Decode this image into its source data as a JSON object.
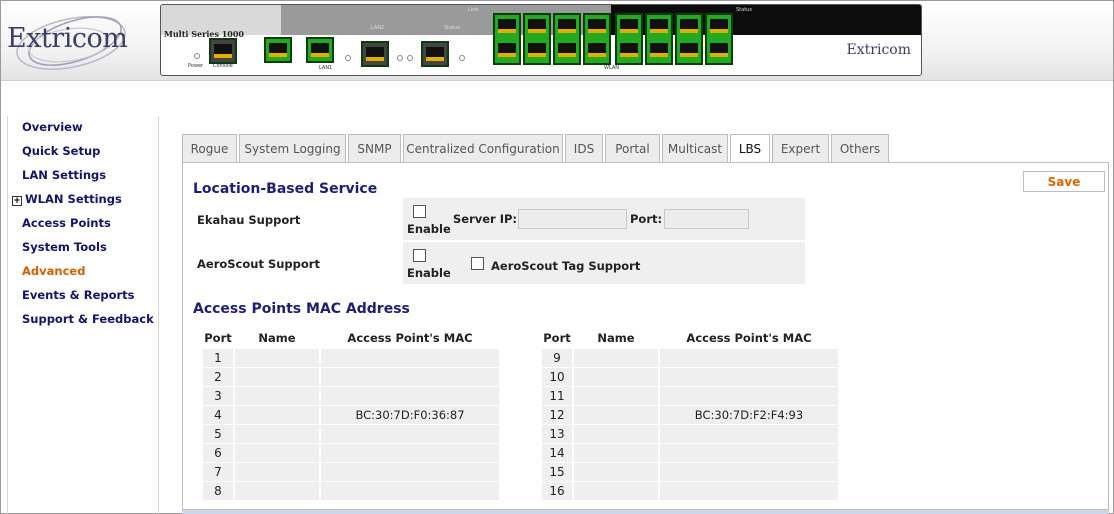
{
  "header": {
    "brand": "Extricom",
    "device_model": "Multi Series 1000",
    "device_brand": "Extricom",
    "labels": {
      "power": "Power",
      "console": "Console",
      "lan1": "LAN1",
      "lan2": "LAN2",
      "link": "Link",
      "status": "Status",
      "wlan": "WLAN"
    }
  },
  "sidebar": {
    "items": [
      {
        "label": "Overview"
      },
      {
        "label": "Quick Setup"
      },
      {
        "label": "LAN Settings"
      },
      {
        "label": "WLAN Settings",
        "expandable": true,
        "expand_symbol": "+"
      },
      {
        "label": "Access Points"
      },
      {
        "label": "System Tools"
      },
      {
        "label": "Advanced",
        "active": true
      },
      {
        "label": "Events & Reports"
      },
      {
        "label": "Support & Feedback"
      }
    ]
  },
  "tabs": [
    {
      "label": "Rogue"
    },
    {
      "label": "System Logging"
    },
    {
      "label": "SNMP"
    },
    {
      "label": "Centralized Configuration"
    },
    {
      "label": "IDS"
    },
    {
      "label": "Portal"
    },
    {
      "label": "Multicast"
    },
    {
      "label": "LBS",
      "active": true
    },
    {
      "label": "Expert"
    },
    {
      "label": "Others"
    }
  ],
  "lbs": {
    "title": "Location-Based Service",
    "save_label": "Save",
    "ekahau": {
      "label": "Ekahau Support",
      "enable_label": "Enable",
      "enabled": false,
      "server_ip_label": "Server IP:",
      "server_ip_value": "",
      "port_label": "Port:",
      "port_value": ""
    },
    "aeroscout": {
      "label": "AeroScout Support",
      "enable_label": "Enable",
      "enabled": false,
      "tag_support_label": "AeroScout Tag Support",
      "tag_support": false
    }
  },
  "mac_section": {
    "title": "Access Points MAC Address",
    "columns": {
      "port": "Port",
      "name": "Name",
      "mac": "Access Point's MAC"
    },
    "left_rows": [
      {
        "port": "1",
        "name": "",
        "mac": ""
      },
      {
        "port": "2",
        "name": "",
        "mac": ""
      },
      {
        "port": "3",
        "name": "",
        "mac": ""
      },
      {
        "port": "4",
        "name": "",
        "mac": "BC:30:7D:F0:36:87"
      },
      {
        "port": "5",
        "name": "",
        "mac": ""
      },
      {
        "port": "6",
        "name": "",
        "mac": ""
      },
      {
        "port": "7",
        "name": "",
        "mac": ""
      },
      {
        "port": "8",
        "name": "",
        "mac": ""
      }
    ],
    "right_rows": [
      {
        "port": "9",
        "name": "",
        "mac": ""
      },
      {
        "port": "10",
        "name": "",
        "mac": ""
      },
      {
        "port": "11",
        "name": "",
        "mac": ""
      },
      {
        "port": "12",
        "name": "",
        "mac": "BC:30:7D:F2:F4:93"
      },
      {
        "port": "13",
        "name": "",
        "mac": ""
      },
      {
        "port": "14",
        "name": "",
        "mac": ""
      },
      {
        "port": "15",
        "name": "",
        "mac": ""
      },
      {
        "port": "16",
        "name": "",
        "mac": ""
      }
    ]
  },
  "colors": {
    "nav_text": "#14146b",
    "nav_active": "#d46000",
    "section_title": "#1e1e77",
    "save_text": "#e06400",
    "port_green": "#22aa22"
  }
}
